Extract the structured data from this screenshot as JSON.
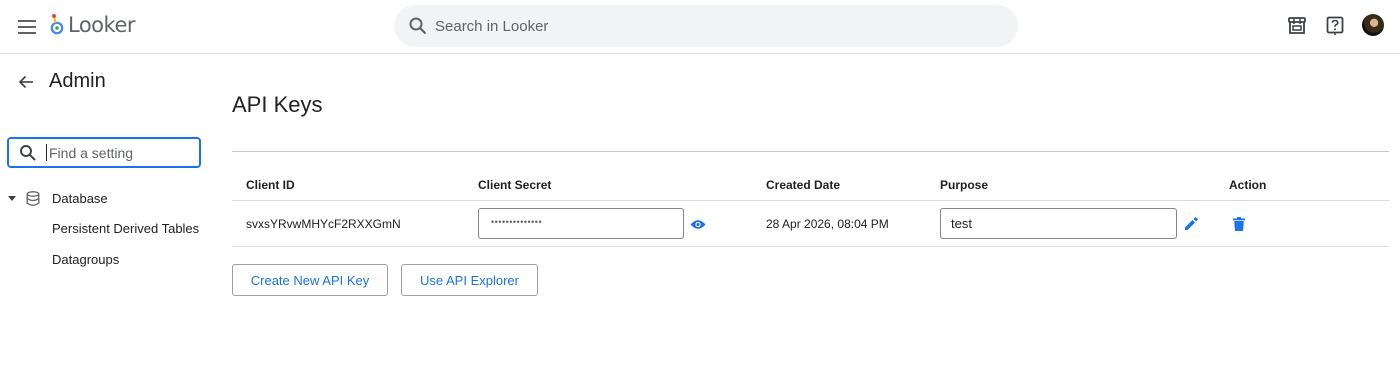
{
  "header": {
    "logo_text": "Looker",
    "search_placeholder": "Search in Looker",
    "icons": [
      "menu-icon",
      "marketplace-icon",
      "help-icon",
      "avatar"
    ]
  },
  "sidebar": {
    "title": "Admin",
    "search_placeholder": "Find a setting",
    "section": {
      "label": "Database",
      "items": [
        "Persistent Derived Tables",
        "Datagroups"
      ]
    }
  },
  "main": {
    "title": "API Keys",
    "columns": [
      "Client ID",
      "Client Secret",
      "Created Date",
      "Purpose",
      "Action"
    ],
    "rows": [
      {
        "client_id": "svxsYRvwMHYcF2RXXGmN",
        "client_secret_masked": "••••••••••••••",
        "created_date": "28 Apr 2026, 08:04 PM",
        "purpose": "test"
      }
    ],
    "buttons": {
      "create": "Create New API Key",
      "explorer": "Use API Explorer"
    }
  },
  "colors": {
    "accent": "#1a73e8",
    "text": "#202124",
    "muted": "#5f6368",
    "search_bg": "#f1f3f4"
  }
}
